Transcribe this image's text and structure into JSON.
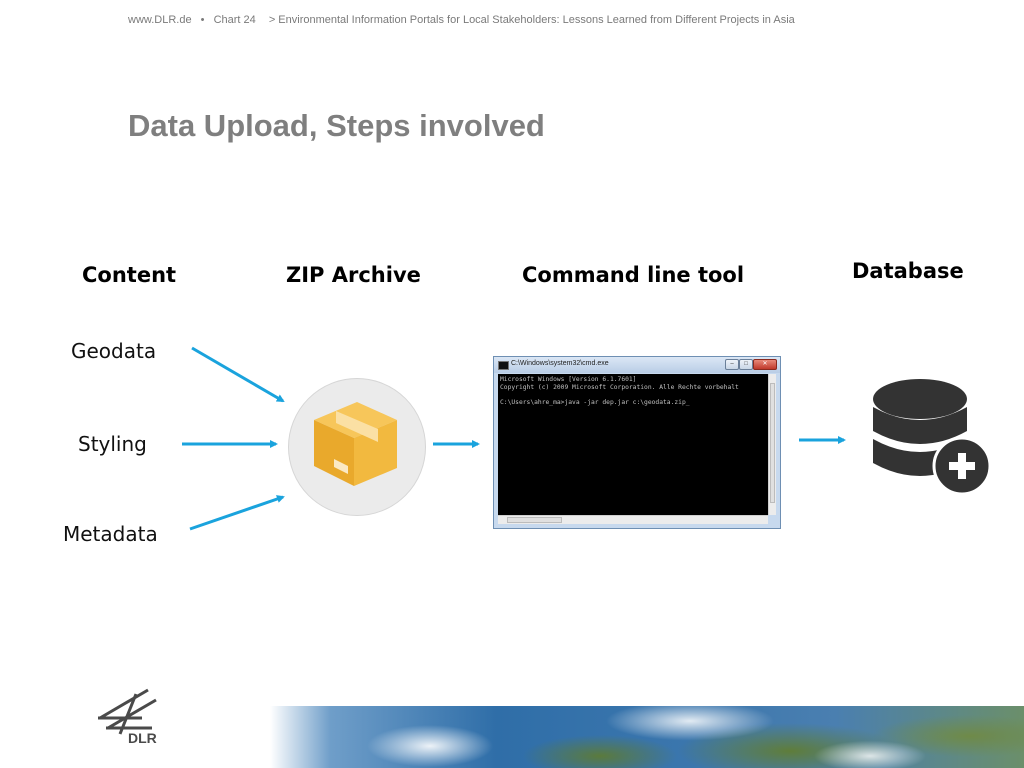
{
  "header": {
    "site": "www.DLR.de",
    "separator": "•",
    "chart": "Chart 24",
    "breadcrumb": "> Environmental Information Portals for Local Stakeholders: Lessons Learned from Different Projects in Asia"
  },
  "title": "Data Upload, Steps involved",
  "columns": {
    "content": "Content",
    "zip": "ZIP Archive",
    "cli": "Command line tool",
    "database": "Database"
  },
  "content_items": [
    "Geodata",
    "Styling",
    "Metadata"
  ],
  "cmd": {
    "window_title": "C:\\Windows\\system32\\cmd.exe",
    "lines": [
      "Microsoft Windows [Version 6.1.7601]",
      "Copyright (c) 2009 Microsoft Corporation. Alle Rechte vorbehalt",
      "",
      "C:\\Users\\ahre_ma>java -jar dep.jar c:\\geodata.zip_"
    ]
  },
  "logo_text": "DLR",
  "colors": {
    "arrow": "#1aa3dd",
    "title": "#7f7f7f",
    "box_dark": "#e9a92c",
    "box_light": "#f7c65a",
    "db": "#333333"
  },
  "icons": {
    "zip": "package-box-icon",
    "database": "database-add-icon"
  }
}
